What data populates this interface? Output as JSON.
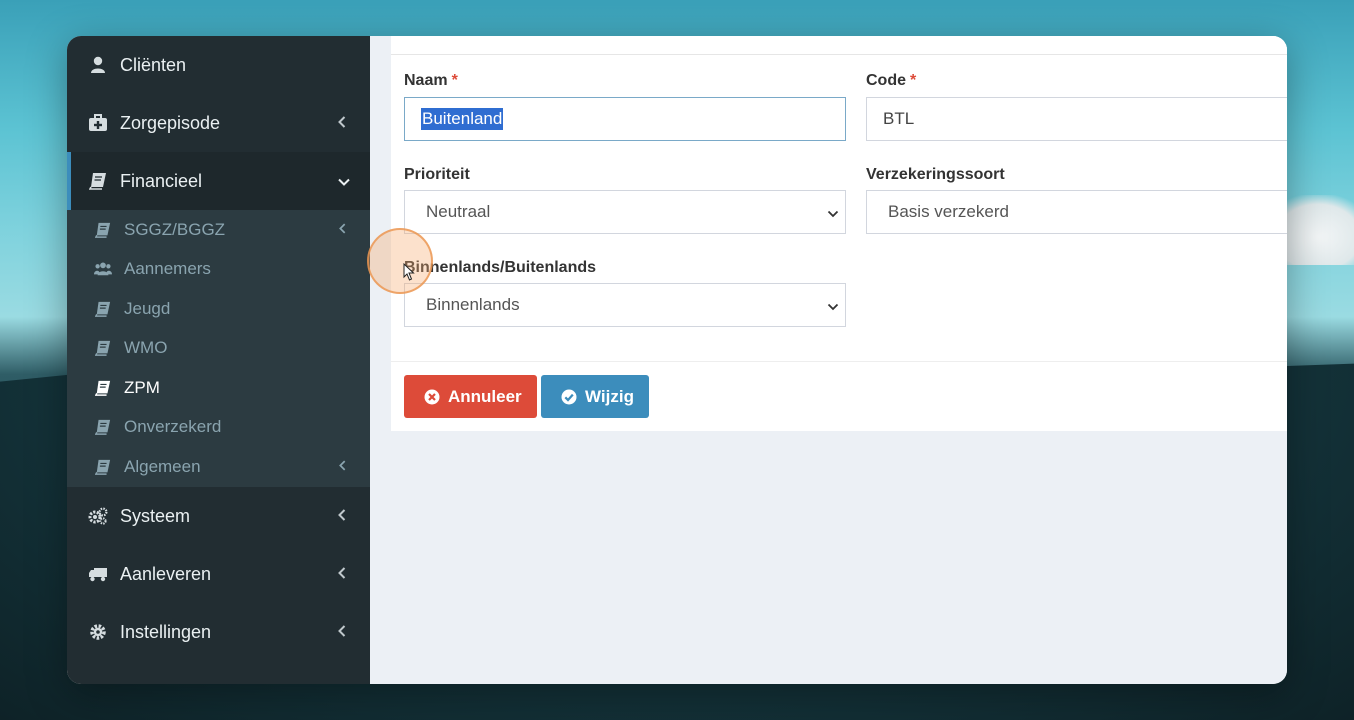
{
  "sidebar": {
    "items": [
      {
        "label": "Cliënten",
        "icon": "user-icon"
      },
      {
        "label": "Zorgepisode",
        "icon": "medkit-icon"
      },
      {
        "label": "Financieel",
        "icon": "book-icon"
      },
      {
        "label": "Systeem",
        "icon": "gears-icon"
      },
      {
        "label": "Aanleveren",
        "icon": "truck-icon"
      },
      {
        "label": "Instellingen",
        "icon": "gear-icon"
      }
    ],
    "submenu": [
      {
        "label": "SGGZ/BGGZ",
        "icon": "book-icon"
      },
      {
        "label": "Aannemers",
        "icon": "users-icon"
      },
      {
        "label": "Jeugd",
        "icon": "book-icon"
      },
      {
        "label": "WMO",
        "icon": "book-icon"
      },
      {
        "label": "ZPM",
        "icon": "book-icon"
      },
      {
        "label": "Onverzekerd",
        "icon": "book-icon"
      },
      {
        "label": "Algemeen",
        "icon": "book-icon"
      }
    ]
  },
  "form": {
    "naam": {
      "label": "Naam",
      "required": "*",
      "value": "Buitenland"
    },
    "code": {
      "label": "Code",
      "required": "*",
      "value": "BTL"
    },
    "prioriteit": {
      "label": "Prioriteit",
      "value": "Neutraal"
    },
    "verzekeringssoort": {
      "label": "Verzekeringssoort",
      "value": "Basis verzekerd"
    },
    "binnenlands": {
      "label": "Binnenlands/Buitenlands",
      "value": "Binnenlands"
    }
  },
  "buttons": {
    "cancel": "Annuleer",
    "save": "Wijzig"
  },
  "colors": {
    "sidebar": "#222d32",
    "submenu": "#2c3b41",
    "accent": "#3c8dbc",
    "danger": "#dd4b39",
    "selection": "#2f6dd1"
  }
}
